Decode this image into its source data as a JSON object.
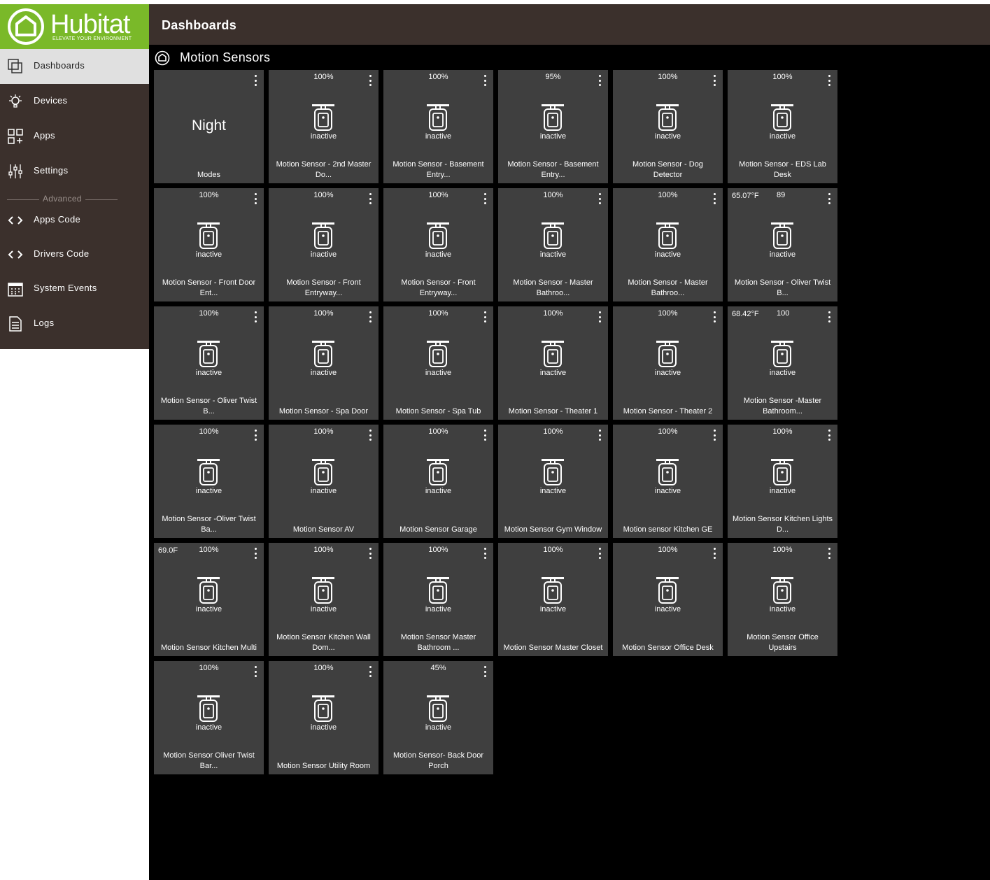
{
  "brand": {
    "name": "Hubitat",
    "tagline": "ELEVATE YOUR ENVIRONMENT",
    "accent": "#7ab929"
  },
  "colors": {
    "sidebar_bg": "#3b302c",
    "active_nav_bg": "#e0e0e0",
    "tile_bg": "#3f3f3f",
    "dashboard_bg": "#000000"
  },
  "header": {
    "title": "Dashboards"
  },
  "sidebar": {
    "items": [
      {
        "label": "Dashboards",
        "icon": "dashboards-icon",
        "active": true
      },
      {
        "label": "Devices",
        "icon": "devices-icon"
      },
      {
        "label": "Apps",
        "icon": "apps-icon"
      },
      {
        "label": "Settings",
        "icon": "settings-icon"
      }
    ],
    "divider_label": "Advanced",
    "advanced_items": [
      {
        "label": "Apps Code",
        "icon": "code-icon"
      },
      {
        "label": "Drivers Code",
        "icon": "code-icon"
      },
      {
        "label": "System Events",
        "icon": "calendar-icon"
      },
      {
        "label": "Logs",
        "icon": "document-icon"
      }
    ]
  },
  "dashboard": {
    "title": "Motion Sensors",
    "tiles": [
      {
        "type": "mode",
        "value": "Night",
        "label": "Modes"
      },
      {
        "battery": "100%",
        "state": "inactive",
        "label": "Motion Sensor - 2nd Master Do..."
      },
      {
        "battery": "100%",
        "state": "inactive",
        "label": "Motion Sensor - Basement Entry..."
      },
      {
        "battery": "95%",
        "state": "inactive",
        "label": "Motion Sensor - Basement Entry..."
      },
      {
        "battery": "100%",
        "state": "inactive",
        "label": "Motion Sensor - Dog Detector"
      },
      {
        "battery": "100%",
        "state": "inactive",
        "label": "Motion Sensor - EDS Lab Desk"
      },
      {
        "battery": "100%",
        "state": "inactive",
        "label": "Motion Sensor - Front Door Ent..."
      },
      {
        "battery": "100%",
        "state": "inactive",
        "label": "Motion Sensor - Front Entryway..."
      },
      {
        "battery": "100%",
        "state": "inactive",
        "label": "Motion Sensor - Front Entryway..."
      },
      {
        "battery": "100%",
        "state": "inactive",
        "label": "Motion Sensor - Master Bathroo..."
      },
      {
        "battery": "100%",
        "state": "inactive",
        "label": "Motion Sensor - Master Bathroo..."
      },
      {
        "temp": "65.07°F",
        "humidity": "89",
        "state": "inactive",
        "label": "Motion Sensor - Oliver Twist B..."
      },
      {
        "battery": "100%",
        "state": "inactive",
        "label": "Motion Sensor - Oliver Twist B..."
      },
      {
        "battery": "100%",
        "state": "inactive",
        "label": "Motion Sensor - Spa Door"
      },
      {
        "battery": "100%",
        "state": "inactive",
        "label": "Motion Sensor - Spa Tub"
      },
      {
        "battery": "100%",
        "state": "inactive",
        "label": "Motion Sensor - Theater 1"
      },
      {
        "battery": "100%",
        "state": "inactive",
        "label": "Motion Sensor - Theater 2"
      },
      {
        "temp": "68.42°F",
        "humidity": "100",
        "state": "inactive",
        "label": "Motion Sensor -Master Bathroom..."
      },
      {
        "battery": "100%",
        "state": "inactive",
        "label": "Motion Sensor -Oliver Twist Ba..."
      },
      {
        "battery": "100%",
        "state": "inactive",
        "label": "Motion Sensor AV"
      },
      {
        "battery": "100%",
        "state": "inactive",
        "label": "Motion Sensor Garage"
      },
      {
        "battery": "100%",
        "state": "inactive",
        "label": "Motion Sensor Gym Window"
      },
      {
        "battery": "100%",
        "state": "inactive",
        "label": "Motion sensor Kitchen GE"
      },
      {
        "battery": "100%",
        "state": "inactive",
        "label": "Motion Sensor Kitchen Lights D..."
      },
      {
        "temp": "69.0F",
        "battery": "100%",
        "state": "inactive",
        "label": "Motion Sensor Kitchen Multi"
      },
      {
        "battery": "100%",
        "state": "inactive",
        "label": "Motion Sensor Kitchen Wall Dom..."
      },
      {
        "battery": "100%",
        "state": "inactive",
        "label": "Motion Sensor Master Bathroom ..."
      },
      {
        "battery": "100%",
        "state": "inactive",
        "label": "Motion Sensor Master Closet"
      },
      {
        "battery": "100%",
        "state": "inactive",
        "label": "Motion Sensor Office Desk"
      },
      {
        "battery": "100%",
        "state": "inactive",
        "label": "Motion Sensor Office Upstairs"
      },
      {
        "battery": "100%",
        "state": "inactive",
        "label": "Motion Sensor Oliver Twist Bar..."
      },
      {
        "battery": "100%",
        "state": "inactive",
        "label": "Motion Sensor Utility Room"
      },
      {
        "battery": "45%",
        "state": "inactive",
        "label": "Motion Sensor- Back Door Porch"
      }
    ]
  }
}
